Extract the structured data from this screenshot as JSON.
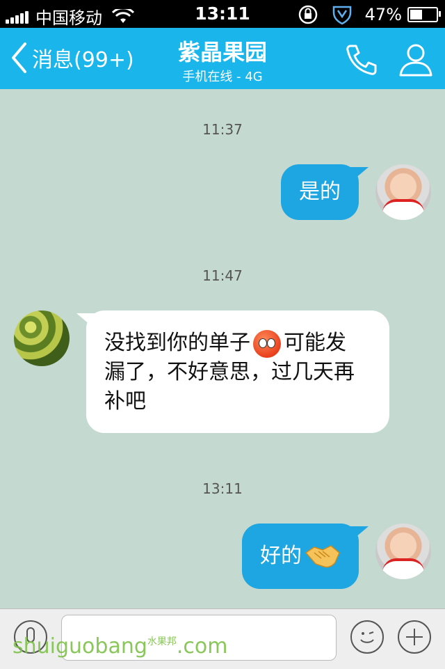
{
  "status_bar": {
    "carrier": "中国移动",
    "time": "13:11",
    "battery": "47%",
    "battery_level": 0.47
  },
  "nav": {
    "back_label": "消息(99+)",
    "title": "紫晶果园",
    "subtitle": "手机在线 - 4G"
  },
  "messages": [
    {
      "timestamp": "11:37",
      "text": "是的"
    },
    {
      "timestamp": "11:47",
      "line1_a": "没找到你的单子",
      "line1_b": "可能发",
      "line2": "漏了，不好意思，过几天再",
      "line3": "补吧"
    },
    {
      "timestamp": "13:11",
      "text": "好的"
    }
  ],
  "watermark": {
    "main": "shuiguobang",
    "cn": "水果邦",
    "com": ".com"
  },
  "colors": {
    "nav": "#1ab5eb",
    "outgoing_bubble": "#1ea6e2",
    "background": "#c4d9d0"
  },
  "icons": [
    "signal-icon",
    "wifi-icon",
    "rotation-lock-icon",
    "shield-icon",
    "battery-icon",
    "back-chevron-icon",
    "phone-icon",
    "profile-icon",
    "voice-icon",
    "emoji-icon",
    "plus-icon"
  ]
}
